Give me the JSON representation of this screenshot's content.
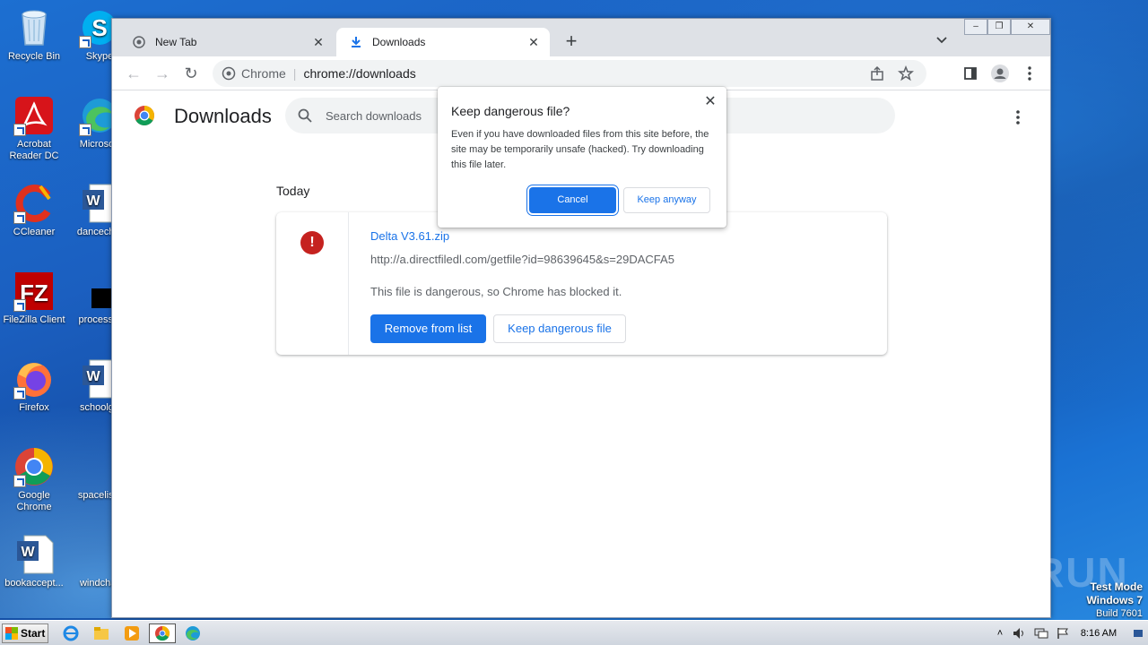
{
  "desktop": {
    "icons": [
      {
        "label": "Recycle Bin",
        "icon": "recycle-bin-icon"
      },
      {
        "label": "Skype",
        "icon": "skype-icon"
      },
      {
        "label": "Acrobat Reader DC",
        "icon": "acrobat-icon"
      },
      {
        "label": "Microsoft",
        "icon": "edge-icon"
      },
      {
        "label": "CCleaner",
        "icon": "ccleaner-icon"
      },
      {
        "label": "dancechin",
        "icon": "word-doc-icon"
      },
      {
        "label": "FileZilla Client",
        "icon": "filezilla-icon"
      },
      {
        "label": "processin",
        "icon": "black-file-icon"
      },
      {
        "label": "Firefox",
        "icon": "firefox-icon"
      },
      {
        "label": "schoolgu",
        "icon": "word-doc-icon"
      },
      {
        "label": "Google Chrome",
        "icon": "chrome-icon"
      },
      {
        "label": "spacelists",
        "icon": "blank-file-icon"
      },
      {
        "label": "bookaccept...",
        "icon": "word-doc-icon"
      },
      {
        "label": "windchar",
        "icon": "blank-file-icon"
      }
    ]
  },
  "browser": {
    "tabs": [
      {
        "label": "New Tab",
        "icon": "chrome-icon",
        "active": false
      },
      {
        "label": "Downloads",
        "icon": "download-icon",
        "active": true
      }
    ],
    "omnibox": {
      "site": "Chrome",
      "url": "chrome://downloads"
    }
  },
  "downloads_page": {
    "title": "Downloads",
    "search_placeholder": "Search downloads",
    "section": "Today",
    "item": {
      "filename": "Delta V3.61.zip",
      "url": "http://a.directfiledl.com/getfile?id=98639645&s=29DACFA5",
      "status": "This file is dangerous, so Chrome has blocked it.",
      "remove_label": "Remove from list",
      "keep_label": "Keep dangerous file"
    }
  },
  "dialog": {
    "title": "Keep dangerous file?",
    "body": "Even if you have downloaded files from this site before, the site may be temporarily unsafe (hacked). Try downloading this file later.",
    "cancel_label": "Cancel",
    "keep_label": "Keep anyway"
  },
  "watermark": "ANY RUN",
  "os_info": {
    "mode": "Test Mode",
    "os": "Windows 7",
    "build": "Build 7601"
  },
  "taskbar": {
    "start_label": "Start",
    "apps": [
      "ie-icon",
      "explorer-icon",
      "media-player-icon",
      "chrome-icon",
      "edge-icon"
    ],
    "time": "8:16 AM"
  },
  "colors": {
    "accent": "#1a73e8",
    "danger": "#c5221f"
  }
}
